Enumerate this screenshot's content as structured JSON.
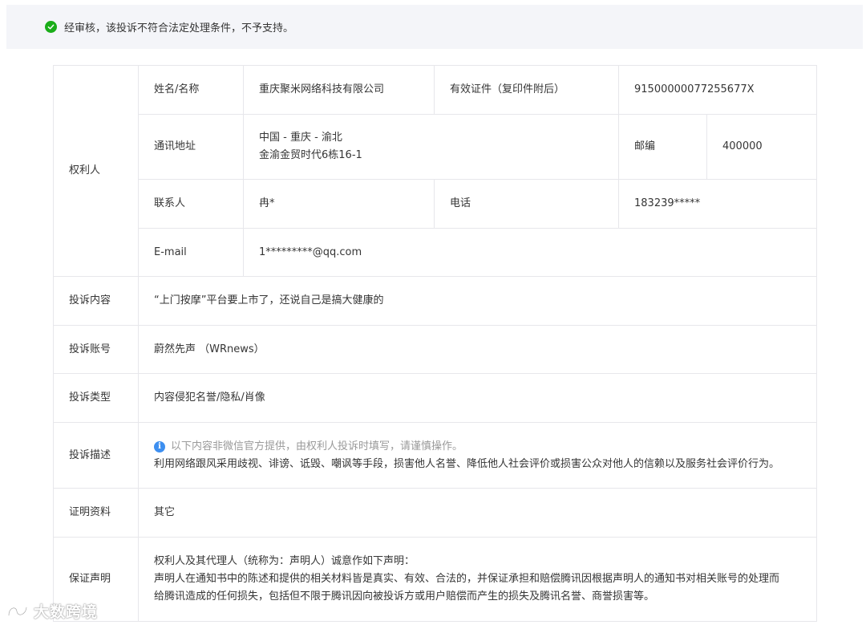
{
  "notice": {
    "text": "经审核，该投诉不符合法定处理条件，不予支持。"
  },
  "rights_holder": {
    "section_label": "权利人",
    "name_label": "姓名/名称",
    "name_value": "重庆聚米网络科技有限公司",
    "id_label": "有效证件（复印件附后）",
    "id_value": "91500000077255677X",
    "address_label": "通讯地址",
    "address_line1": "中国 - 重庆 - 渝北",
    "address_line2": "金渝金贸时代6栋16-1",
    "postcode_label": "邮编",
    "postcode_value": "400000",
    "contact_label": "联系人",
    "contact_value": "冉*",
    "phone_label": "电话",
    "phone_value": "183239*****",
    "email_label": "E-mail",
    "email_value": "1*********@qq.com"
  },
  "complaint": {
    "content_label": "投诉内容",
    "content_value": "“上门按摩”平台要上市了，还说自己是搞大健康的",
    "account_label": "投诉账号",
    "account_value": "蔚然先声 （WRnews）",
    "type_label": "投诉类型",
    "type_value": "内容侵犯名誉/隐私/肖像",
    "desc_label": "投诉描述",
    "desc_notice": "以下内容非微信官方提供，由权利人投诉时填写，请谨慎操作。",
    "desc_value": "利用网络跟风采用歧视、诽谤、诋毁、嘲讽等手段，损害他人名誉、降低他人社会评价或损害公众对他人的信赖以及服务社会评价行为。",
    "evidence_label": "证明资料",
    "evidence_value": "其它",
    "guarantee_label": "保证声明",
    "guarantee_line1": "权利人及其代理人（统称为：声明人）诚意作如下声明：",
    "guarantee_line2": "声明人在通知书中的陈述和提供的相关材料皆是真实、有效、合法的，并保证承担和赔偿腾讯因根据声明人的通知书对相关账号的处理而",
    "guarantee_line3": "给腾讯造成的任何损失，包括但不限于腾讯因向被投诉方或用户赔偿而产生的损失及腾讯名誉、商誉损害等。"
  },
  "watermark": {
    "text": "大数跨境"
  },
  "colors": {
    "success": "#1aad19",
    "info": "#3d8ff0",
    "border": "#e7e7eb",
    "notice_bg": "#f4f5f9"
  },
  "icons": {
    "notice_icon": "check-circle-icon",
    "desc_icon": "info-circle-icon",
    "watermark_icon": "logo-mark"
  }
}
